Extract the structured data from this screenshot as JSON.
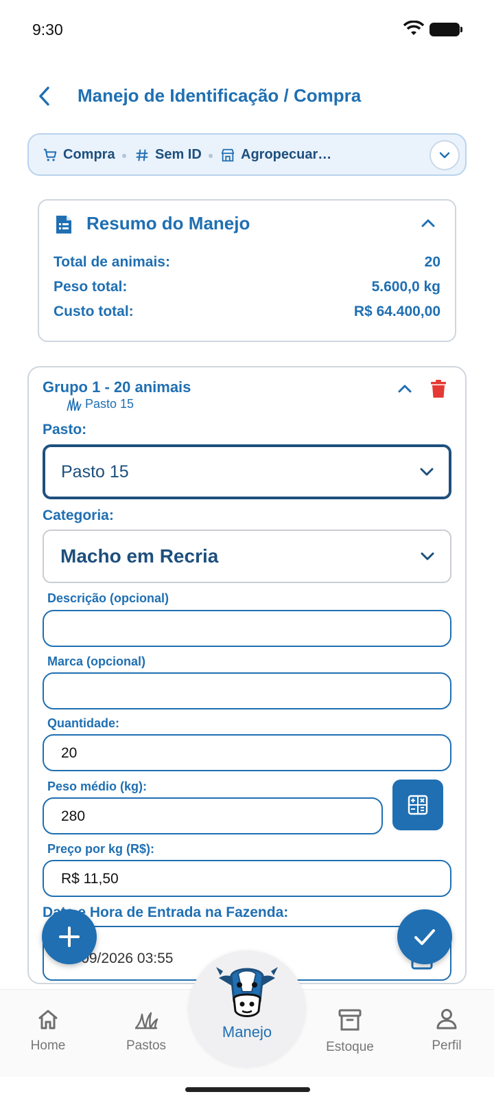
{
  "status_bar": {
    "time": "9:30"
  },
  "header": {
    "title": "Manejo de Identificação / Compra"
  },
  "chips": [
    {
      "label": "Compra",
      "icon": "cart-icon"
    },
    {
      "label": "Sem ID",
      "icon": "hash-icon"
    },
    {
      "label": "Agropecuar…",
      "icon": "store-icon"
    }
  ],
  "summary": {
    "title": "Resumo do Manejo",
    "rows": [
      {
        "label": "Total de animais:",
        "value": "20"
      },
      {
        "label": "Peso total:",
        "value": "5.600,0 kg"
      },
      {
        "label": "Custo total:",
        "value": "R$ 64.400,00"
      }
    ]
  },
  "group": {
    "title": "Grupo 1 - 20 animais",
    "subtitle": "Pasto 15",
    "pasto_label": "Pasto:",
    "pasto_value": "Pasto 15",
    "categoria_label": "Categoria:",
    "categoria_value": "Macho em Recria",
    "descricao_label": "Descrição (opcional)",
    "descricao_value": "",
    "marca_label": "Marca (opcional)",
    "marca_value": "",
    "quantidade_label": "Quantidade:",
    "quantidade_value": "20",
    "peso_label": "Peso médio (kg):",
    "peso_value": "280",
    "preco_label": "Preço por kg (R$):",
    "preco_value": "R$ 11,50",
    "data_label": "Data e Hora de Entrada na Fazenda:",
    "data_value": "14/09/2026 03:55"
  },
  "bottom_nav": {
    "home": "Home",
    "pastos": "Pastos",
    "manejo": "Manejo",
    "estoque": "Estoque",
    "perfil": "Perfil"
  },
  "colors": {
    "primary": "#1f6fb2",
    "delete": "#e53935",
    "chip_bg": "#eaf2fb"
  }
}
